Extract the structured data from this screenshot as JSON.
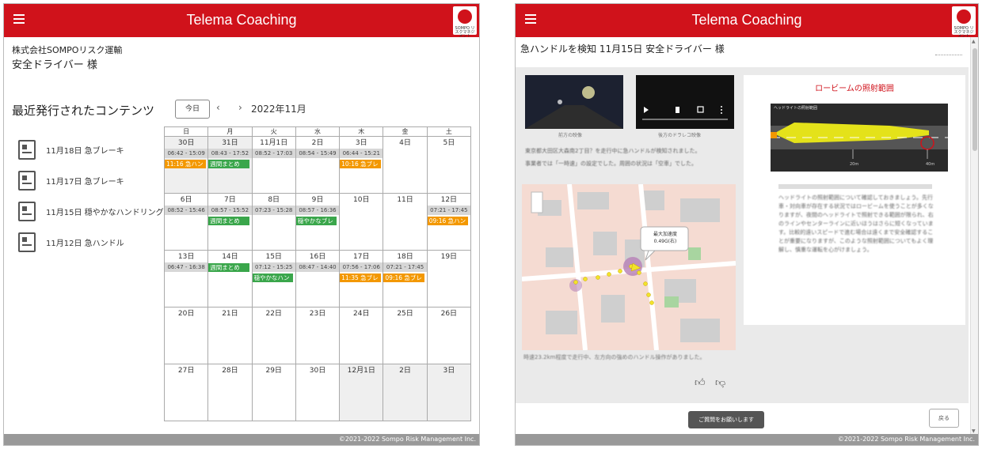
{
  "app": {
    "title": "Telema Coaching",
    "logo_text": "SOMPO リスクマネジメント",
    "copyright": "©2021-2022 Sompo Risk Management Inc."
  },
  "left": {
    "company": "株式会社SOMPOリスク運輸",
    "driver": "安全ドライバー 様",
    "section_title": "最近発行されたコンテンツ",
    "today_button": "今日",
    "prev": "‹",
    "next": "›",
    "month": "2022年11月",
    "list": [
      {
        "label": "11月18日 急ブレーキ"
      },
      {
        "label": "11月17日 急ブレーキ"
      },
      {
        "label": "11月15日 穏やかなハンドリング"
      },
      {
        "label": "11月12日 急ハンドル"
      }
    ],
    "weekdays": [
      "日",
      "月",
      "火",
      "水",
      "木",
      "金",
      "土"
    ],
    "weeks": [
      [
        {
          "day": "30日",
          "time": "06:42 - 15:09",
          "events": [
            {
              "text": "11:16 急ハン",
              "color": "orange"
            }
          ],
          "grey": true
        },
        {
          "day": "31日",
          "time": "08:43 - 17:52",
          "events": [
            {
              "text": "週間まとめ",
              "color": "green"
            }
          ],
          "grey": true
        },
        {
          "day": "11月1日",
          "time": "08:52 - 17:03",
          "events": []
        },
        {
          "day": "2日",
          "time": "08:54 - 15:49",
          "events": []
        },
        {
          "day": "3日",
          "time": "06:44 - 15:21",
          "events": [
            {
              "text": "10:16 急ブレ",
              "color": "orange"
            }
          ]
        },
        {
          "day": "4日",
          "time": "",
          "events": []
        },
        {
          "day": "5日",
          "time": "",
          "events": []
        }
      ],
      [
        {
          "day": "6日",
          "time": "08:52 - 15:46",
          "events": []
        },
        {
          "day": "7日",
          "time": "08:57 - 15:52",
          "events": [
            {
              "text": "週間まとめ",
              "color": "green"
            }
          ]
        },
        {
          "day": "8日",
          "time": "07:23 - 15:28",
          "events": []
        },
        {
          "day": "9日",
          "time": "08:57 - 16:36",
          "events": [
            {
              "text": "穏やかなブレ",
              "color": "green"
            }
          ]
        },
        {
          "day": "10日",
          "time": "",
          "events": []
        },
        {
          "day": "11日",
          "time": "",
          "events": []
        },
        {
          "day": "12日",
          "time": "07:21 - 17:45",
          "events": [
            {
              "text": "09:16 急ハン",
              "color": "orange"
            }
          ]
        }
      ],
      [
        {
          "day": "13日",
          "time": "06:47 - 16:38",
          "events": []
        },
        {
          "day": "14日",
          "time": "",
          "events": [
            {
              "text": "週間まとめ",
              "color": "green"
            }
          ]
        },
        {
          "day": "15日",
          "time": "07:12 - 15:25",
          "events": [
            {
              "text": "穏やかなハン",
              "color": "green"
            }
          ]
        },
        {
          "day": "16日",
          "time": "08:47 - 14:40",
          "events": []
        },
        {
          "day": "17日",
          "time": "07:56 - 17:06",
          "events": [
            {
              "text": "11:35 急ブレ",
              "color": "orange"
            }
          ]
        },
        {
          "day": "18日",
          "time": "07:21 - 17:45",
          "events": [
            {
              "text": "09:16 急ブレ",
              "color": "orange"
            }
          ]
        },
        {
          "day": "19日",
          "time": "",
          "events": []
        }
      ],
      [
        {
          "day": "20日",
          "time": "",
          "events": []
        },
        {
          "day": "21日",
          "time": "",
          "events": []
        },
        {
          "day": "22日",
          "time": "",
          "events": []
        },
        {
          "day": "23日",
          "time": "",
          "events": []
        },
        {
          "day": "24日",
          "time": "",
          "events": []
        },
        {
          "day": "25日",
          "time": "",
          "events": []
        },
        {
          "day": "26日",
          "time": "",
          "events": []
        }
      ],
      [
        {
          "day": "27日",
          "time": "",
          "events": []
        },
        {
          "day": "28日",
          "time": "",
          "events": []
        },
        {
          "day": "29日",
          "time": "",
          "events": []
        },
        {
          "day": "30日",
          "time": "",
          "events": []
        },
        {
          "day": "12月1日",
          "time": "",
          "events": [],
          "grey": true
        },
        {
          "day": "2日",
          "time": "",
          "events": [],
          "grey": true
        },
        {
          "day": "3日",
          "time": "",
          "events": [],
          "grey": true
        }
      ]
    ]
  },
  "right": {
    "header": "急ハンドルを検知 11月15日 安全ドライバー 様",
    "thumb1_caption": "前方の映像",
    "thumb2_caption": "後方のドラレコ映像",
    "text_lines": [
      "東京都大田区大森南2丁目？を走行中に急ハンドルが検知されました。",
      "事業者では「一時速」の設定でした。周囲の状況は「空車」でした。"
    ],
    "map_popup": "最大加速度 0.49G(右)",
    "map_caption": "時速23.2km程度で走行中、左方向の強めのハンドル操作がありました。",
    "panel_title": "ロービームの照射範囲",
    "beam_label": "ヘッドライトの照射範囲",
    "dist_20": "20m",
    "dist_40": "40m",
    "panel_text": "ヘッドライトの照射範囲について確認しておきましょう。先行車・対向車が存在する状況ではロービームを使うことが多くなりますが、夜間のヘッドライトで照射できる範囲が限られ、右のラインやセンターラインに近いほうはさらに短くなっています。比較的遠いスピードで進む場合は遠くまで安全確認することが重要になりますが、このような照射範囲についてもよく理解し、慎重な運転を心がけましょう。",
    "request_button": "ご質問をお願いします",
    "back_button": "戻る",
    "like_icon": "thumbs-up-icon",
    "dislike_icon": "thumbs-down-icon"
  }
}
